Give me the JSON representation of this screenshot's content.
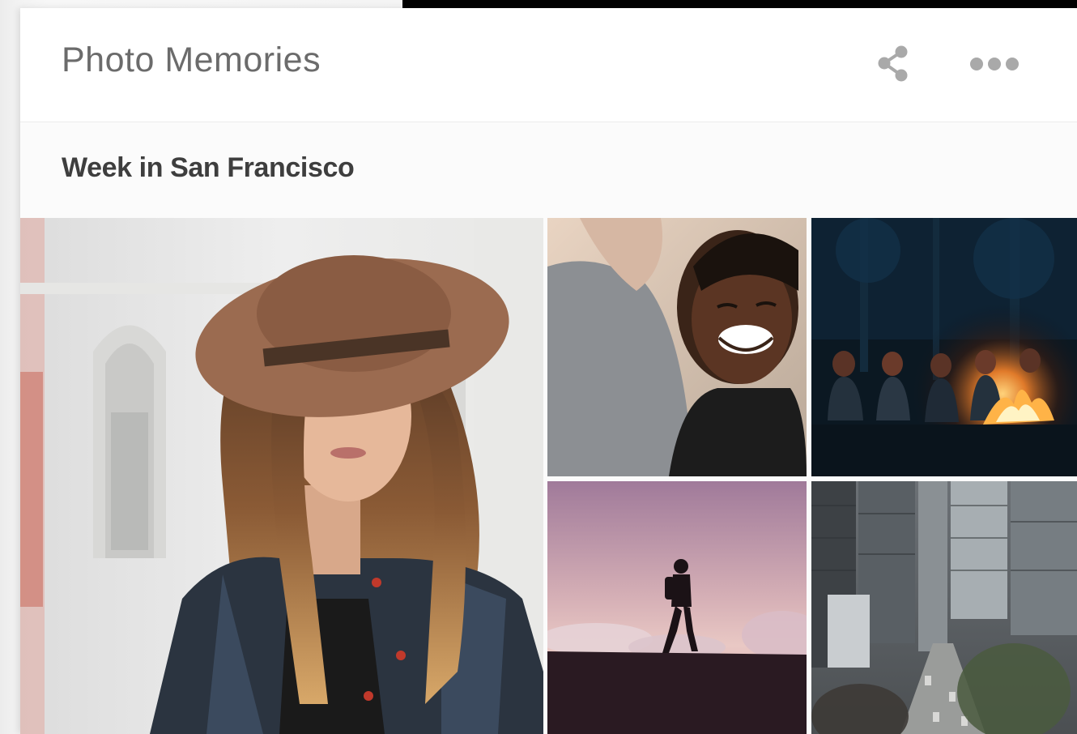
{
  "card": {
    "title": "Photo Memories",
    "actions": [
      {
        "icon": "share-icon"
      },
      {
        "icon": "more-icon"
      }
    ]
  },
  "album": {
    "title": "Week in San Francisco",
    "photos": [
      {
        "subject": "woman-in-hat-portrait"
      },
      {
        "subject": "smiling-woman-portrait"
      },
      {
        "subject": "campfire-night-scene"
      },
      {
        "subject": "silhouette-hiker-at-dusk"
      },
      {
        "subject": "city-street-aerial"
      }
    ]
  },
  "colors": {
    "title_text": "#6b6b6b",
    "subtitle_text": "#3e3e3e",
    "icon_gray": "#a9a9a9",
    "page_background": "#000000"
  }
}
